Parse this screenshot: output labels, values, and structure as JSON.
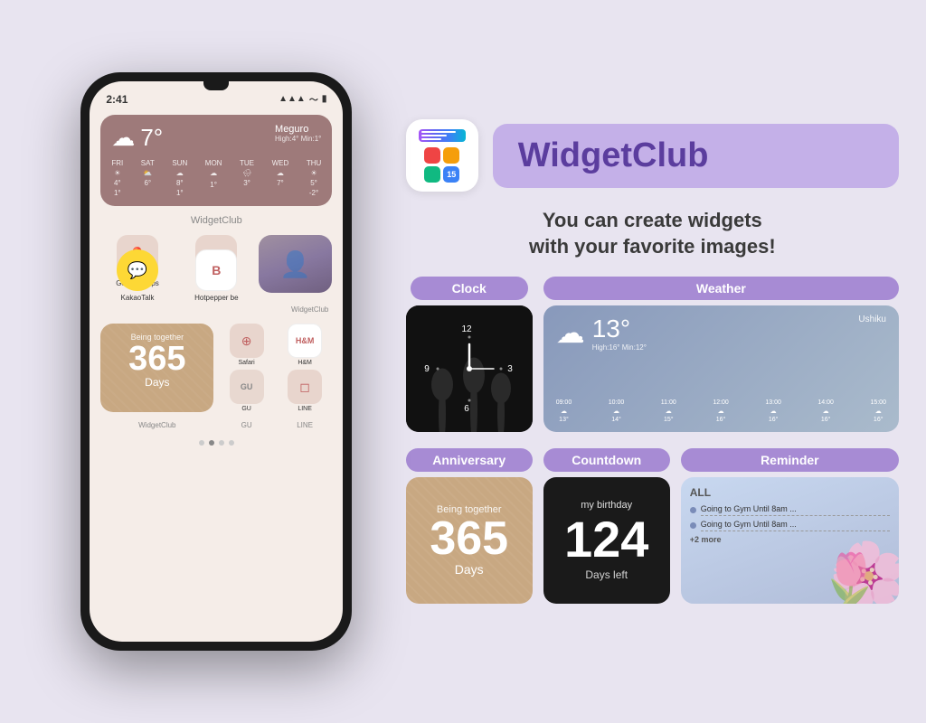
{
  "phone": {
    "time": "2:41",
    "status": {
      "signal": "▲▲▲",
      "wifi": "WiFi",
      "battery": "🔋"
    },
    "weather": {
      "temp": "7°",
      "cloud_icon": "☁",
      "high_low": "High:4° Min:1°",
      "location": "Meguro",
      "days": [
        {
          "label": "FRI",
          "icon": "☀",
          "high": "4°",
          "low": "1°"
        },
        {
          "label": "SAT",
          "icon": "⛅",
          "high": "6°",
          "low": ""
        },
        {
          "label": "SUN",
          "icon": "☁",
          "high": "8°",
          "low": "1°"
        },
        {
          "label": "MON",
          "icon": "☁",
          "high": "",
          "low": "1°"
        },
        {
          "label": "TUE",
          "icon": "🌧",
          "high": "3°",
          "low": ""
        },
        {
          "label": "WED",
          "icon": "⏰",
          "high": "7°",
          "low": ""
        },
        {
          "label": "THU",
          "icon": "☀",
          "high": "5°",
          "low": "-2°"
        }
      ]
    },
    "widget_club_label": "WidgetClub",
    "apps": [
      {
        "name": "Google Maps",
        "icon": "📍",
        "bg": "#e8d5cd"
      },
      {
        "name": "",
        "icon": "◎",
        "bg": "#e8d5cd"
      },
      {
        "name": "WidgetClub",
        "is_photo": true
      }
    ],
    "apps2": [
      {
        "name": "KakaoTalk",
        "icon": "💬",
        "bg": "#ddd"
      },
      {
        "name": "Hotpepper be",
        "icon": "B",
        "bg": "#fff"
      },
      {
        "name": "WidgetClub",
        "icon": "W",
        "bg": "#fff"
      }
    ],
    "anniversary": {
      "being_together": "Being together",
      "number": "365",
      "days": "Days"
    },
    "small_apps": [
      {
        "name": "Safari",
        "icon": "⊕",
        "bg": "#e8d5cd"
      },
      {
        "name": "H&M",
        "icon": "H&M",
        "bg": "#fff"
      },
      {
        "name": "GU",
        "icon": "GU",
        "bg": "#ddd"
      },
      {
        "name": "LINE",
        "icon": "◻",
        "bg": "#e8d5cd"
      }
    ],
    "widget_club_bottom": "WidgetClub",
    "gu_label": "GU",
    "line_label": "LINE"
  },
  "right": {
    "app_name": "WidgetClub",
    "tagline_line1": "You can create widgets",
    "tagline_line2": "with your favorite images!",
    "categories": {
      "clock": {
        "label": "Clock",
        "clock_12": "12",
        "clock_9": "9",
        "clock_3": "3",
        "clock_6": "6"
      },
      "weather": {
        "label": "Weather",
        "temp": "13°",
        "cloud": "☁",
        "high_low": "High:16° Min:12°",
        "location": "Ushiku",
        "hours": [
          "09:00",
          "10:00",
          "11:00",
          "12:00",
          "13:00",
          "14:00",
          "15:00"
        ],
        "hour_icons": [
          "☁",
          "☁",
          "☁",
          "☁",
          "☁",
          "☁",
          "☁"
        ],
        "hour_temps": [
          "13°",
          "14°",
          "15°",
          "16°",
          "16°",
          "16°",
          "16°"
        ]
      },
      "anniversary": {
        "label": "Anniversary",
        "being_together": "Being together",
        "number": "365",
        "days": "Days"
      },
      "countdown": {
        "label": "Countdown",
        "title": "my birthday",
        "number": "124",
        "subtitle": "Days left"
      },
      "reminder": {
        "label": "Reminder",
        "all": "ALL",
        "items": [
          "Going to Gym Until 8am ...",
          "Going to Gym Until 8am ...",
          "+2 more"
        ]
      }
    }
  }
}
